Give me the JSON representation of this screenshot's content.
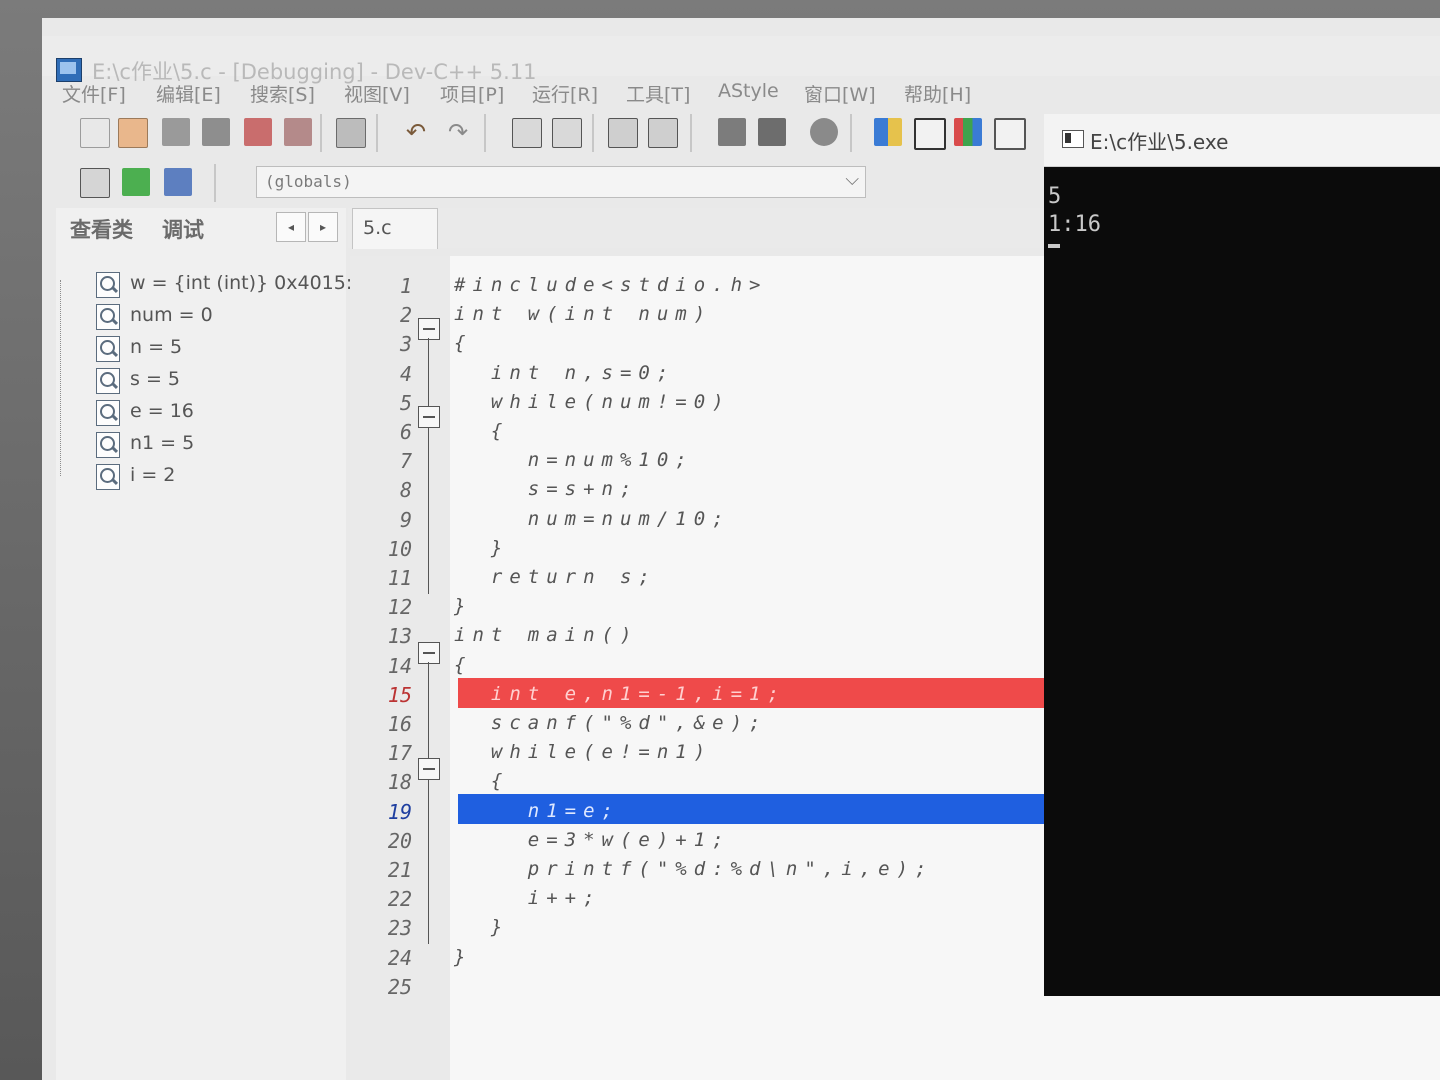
{
  "window": {
    "title": "E:\\c作业\\5.c - [Debugging] - Dev-C++ 5.11"
  },
  "menu": [
    "文件[F]",
    "编辑[E]",
    "搜索[S]",
    "视图[V]",
    "项目[P]",
    "运行[R]",
    "工具[T]",
    "AStyle",
    "窗口[W]",
    "帮助[H]"
  ],
  "toolbar2": {
    "scope_select": "(globals)"
  },
  "left_panel": {
    "tabs": [
      "查看类",
      "调试"
    ],
    "nav_prev": "◂",
    "nav_next": "▸",
    "watches": [
      "w = {int (int)} 0x4015:",
      "num = 0",
      "n = 5",
      "s = 5",
      "e = 16",
      "n1 = 5",
      "i = 2"
    ]
  },
  "editor": {
    "file_tab": "5.c",
    "line_numbers": [
      "1",
      "2",
      "3",
      "4",
      "5",
      "6",
      "7",
      "8",
      "9",
      "10",
      "11",
      "12",
      "13",
      "14",
      "15",
      "16",
      "17",
      "18",
      "19",
      "20",
      "21",
      "22",
      "23",
      "24",
      "25"
    ],
    "lines": [
      "#include<stdio.h>",
      "int w(int num)",
      "{",
      "  int n,s=0;",
      "  while(num!=0)",
      "  {",
      "    n=num%10;",
      "    s=s+n;",
      "    num=num/10;",
      "  }",
      "  return s;",
      "}",
      "int main()",
      "{",
      "  int e,n1=-1,i=1;",
      "  scanf(\"%d\",&e);",
      "  while(e!=n1)",
      "  {",
      "    n1=e;",
      "    e=3*w(e)+1;",
      "    printf(\"%d:%d\\n\",i,e);",
      "    i++;",
      "  }",
      "}",
      ""
    ],
    "breakpoint_line": "15",
    "current_line": "19",
    "colors": {
      "breakpoint": "#ef4a4a",
      "current": "#1f5fe0",
      "symbol": "#e23b4b"
    }
  },
  "console": {
    "title": "E:\\c作业\\5.exe",
    "output": [
      "5",
      "1:16"
    ]
  }
}
